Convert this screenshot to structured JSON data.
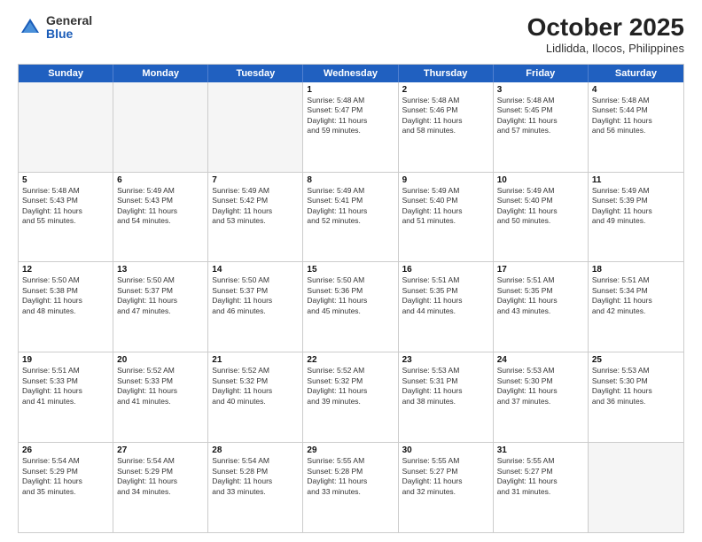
{
  "header": {
    "logo_general": "General",
    "logo_blue": "Blue",
    "month_title": "October 2025",
    "location": "Lidlidda, Ilocos, Philippines"
  },
  "weekdays": [
    "Sunday",
    "Monday",
    "Tuesday",
    "Wednesday",
    "Thursday",
    "Friday",
    "Saturday"
  ],
  "weeks": [
    [
      {
        "day": "",
        "empty": true
      },
      {
        "day": "",
        "empty": true
      },
      {
        "day": "",
        "empty": true
      },
      {
        "day": "1",
        "lines": [
          "Sunrise: 5:48 AM",
          "Sunset: 5:47 PM",
          "Daylight: 11 hours",
          "and 59 minutes."
        ]
      },
      {
        "day": "2",
        "lines": [
          "Sunrise: 5:48 AM",
          "Sunset: 5:46 PM",
          "Daylight: 11 hours",
          "and 58 minutes."
        ]
      },
      {
        "day": "3",
        "lines": [
          "Sunrise: 5:48 AM",
          "Sunset: 5:45 PM",
          "Daylight: 11 hours",
          "and 57 minutes."
        ]
      },
      {
        "day": "4",
        "lines": [
          "Sunrise: 5:48 AM",
          "Sunset: 5:44 PM",
          "Daylight: 11 hours",
          "and 56 minutes."
        ]
      }
    ],
    [
      {
        "day": "5",
        "lines": [
          "Sunrise: 5:48 AM",
          "Sunset: 5:43 PM",
          "Daylight: 11 hours",
          "and 55 minutes."
        ]
      },
      {
        "day": "6",
        "lines": [
          "Sunrise: 5:49 AM",
          "Sunset: 5:43 PM",
          "Daylight: 11 hours",
          "and 54 minutes."
        ]
      },
      {
        "day": "7",
        "lines": [
          "Sunrise: 5:49 AM",
          "Sunset: 5:42 PM",
          "Daylight: 11 hours",
          "and 53 minutes."
        ]
      },
      {
        "day": "8",
        "lines": [
          "Sunrise: 5:49 AM",
          "Sunset: 5:41 PM",
          "Daylight: 11 hours",
          "and 52 minutes."
        ]
      },
      {
        "day": "9",
        "lines": [
          "Sunrise: 5:49 AM",
          "Sunset: 5:40 PM",
          "Daylight: 11 hours",
          "and 51 minutes."
        ]
      },
      {
        "day": "10",
        "lines": [
          "Sunrise: 5:49 AM",
          "Sunset: 5:40 PM",
          "Daylight: 11 hours",
          "and 50 minutes."
        ]
      },
      {
        "day": "11",
        "lines": [
          "Sunrise: 5:49 AM",
          "Sunset: 5:39 PM",
          "Daylight: 11 hours",
          "and 49 minutes."
        ]
      }
    ],
    [
      {
        "day": "12",
        "lines": [
          "Sunrise: 5:50 AM",
          "Sunset: 5:38 PM",
          "Daylight: 11 hours",
          "and 48 minutes."
        ]
      },
      {
        "day": "13",
        "lines": [
          "Sunrise: 5:50 AM",
          "Sunset: 5:37 PM",
          "Daylight: 11 hours",
          "and 47 minutes."
        ]
      },
      {
        "day": "14",
        "lines": [
          "Sunrise: 5:50 AM",
          "Sunset: 5:37 PM",
          "Daylight: 11 hours",
          "and 46 minutes."
        ]
      },
      {
        "day": "15",
        "lines": [
          "Sunrise: 5:50 AM",
          "Sunset: 5:36 PM",
          "Daylight: 11 hours",
          "and 45 minutes."
        ]
      },
      {
        "day": "16",
        "lines": [
          "Sunrise: 5:51 AM",
          "Sunset: 5:35 PM",
          "Daylight: 11 hours",
          "and 44 minutes."
        ]
      },
      {
        "day": "17",
        "lines": [
          "Sunrise: 5:51 AM",
          "Sunset: 5:35 PM",
          "Daylight: 11 hours",
          "and 43 minutes."
        ]
      },
      {
        "day": "18",
        "lines": [
          "Sunrise: 5:51 AM",
          "Sunset: 5:34 PM",
          "Daylight: 11 hours",
          "and 42 minutes."
        ]
      }
    ],
    [
      {
        "day": "19",
        "lines": [
          "Sunrise: 5:51 AM",
          "Sunset: 5:33 PM",
          "Daylight: 11 hours",
          "and 41 minutes."
        ]
      },
      {
        "day": "20",
        "lines": [
          "Sunrise: 5:52 AM",
          "Sunset: 5:33 PM",
          "Daylight: 11 hours",
          "and 41 minutes."
        ]
      },
      {
        "day": "21",
        "lines": [
          "Sunrise: 5:52 AM",
          "Sunset: 5:32 PM",
          "Daylight: 11 hours",
          "and 40 minutes."
        ]
      },
      {
        "day": "22",
        "lines": [
          "Sunrise: 5:52 AM",
          "Sunset: 5:32 PM",
          "Daylight: 11 hours",
          "and 39 minutes."
        ]
      },
      {
        "day": "23",
        "lines": [
          "Sunrise: 5:53 AM",
          "Sunset: 5:31 PM",
          "Daylight: 11 hours",
          "and 38 minutes."
        ]
      },
      {
        "day": "24",
        "lines": [
          "Sunrise: 5:53 AM",
          "Sunset: 5:30 PM",
          "Daylight: 11 hours",
          "and 37 minutes."
        ]
      },
      {
        "day": "25",
        "lines": [
          "Sunrise: 5:53 AM",
          "Sunset: 5:30 PM",
          "Daylight: 11 hours",
          "and 36 minutes."
        ]
      }
    ],
    [
      {
        "day": "26",
        "lines": [
          "Sunrise: 5:54 AM",
          "Sunset: 5:29 PM",
          "Daylight: 11 hours",
          "and 35 minutes."
        ]
      },
      {
        "day": "27",
        "lines": [
          "Sunrise: 5:54 AM",
          "Sunset: 5:29 PM",
          "Daylight: 11 hours",
          "and 34 minutes."
        ]
      },
      {
        "day": "28",
        "lines": [
          "Sunrise: 5:54 AM",
          "Sunset: 5:28 PM",
          "Daylight: 11 hours",
          "and 33 minutes."
        ]
      },
      {
        "day": "29",
        "lines": [
          "Sunrise: 5:55 AM",
          "Sunset: 5:28 PM",
          "Daylight: 11 hours",
          "and 33 minutes."
        ]
      },
      {
        "day": "30",
        "lines": [
          "Sunrise: 5:55 AM",
          "Sunset: 5:27 PM",
          "Daylight: 11 hours",
          "and 32 minutes."
        ]
      },
      {
        "day": "31",
        "lines": [
          "Sunrise: 5:55 AM",
          "Sunset: 5:27 PM",
          "Daylight: 11 hours",
          "and 31 minutes."
        ]
      },
      {
        "day": "",
        "empty": true
      }
    ]
  ]
}
